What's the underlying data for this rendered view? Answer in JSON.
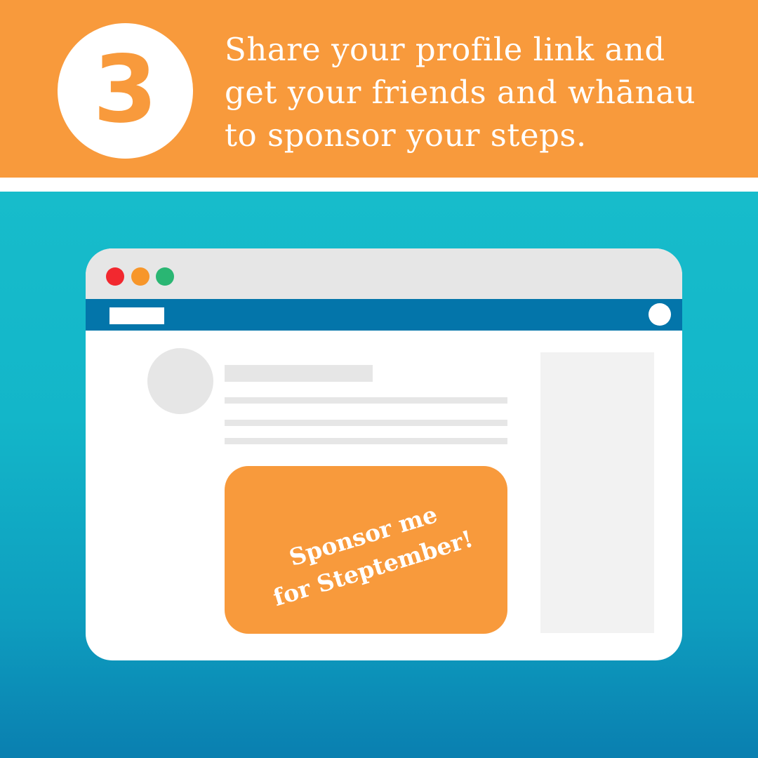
{
  "banner": {
    "step_number": "3",
    "text": "Share your profile link and\nget your friends and whānau\nto sponsor your steps.",
    "color": "#f89a3c"
  },
  "browser": {
    "window_controls": [
      {
        "name": "close-dot",
        "color": "#f2282f"
      },
      {
        "name": "minimize-dot",
        "color": "#f7962a"
      },
      {
        "name": "maximize-dot",
        "color": "#2ab673"
      }
    ],
    "nav_color": "#0375aa"
  },
  "sponsor_card": {
    "text": "Sponsor me\nfor Steptember!"
  }
}
